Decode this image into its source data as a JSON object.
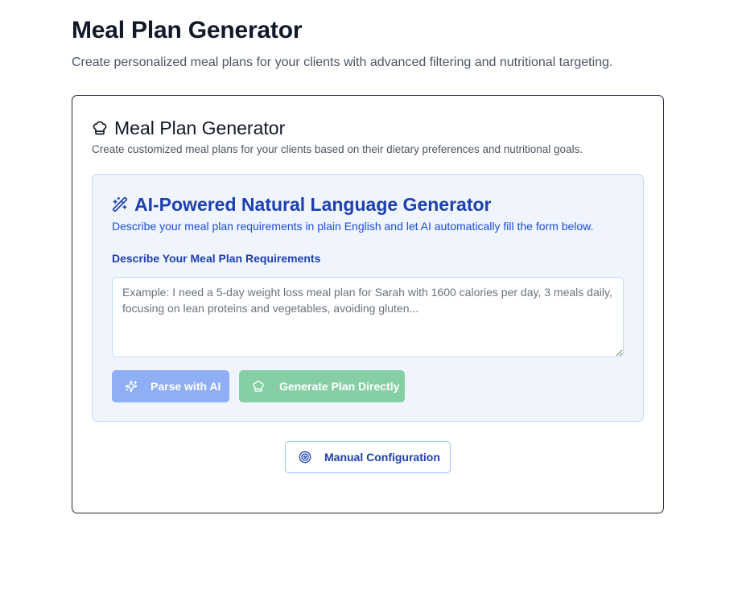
{
  "page": {
    "title": "Meal Plan Generator",
    "subtitle": "Create personalized meal plans for your clients with advanced filtering and nutritional targeting."
  },
  "card": {
    "icon": "chef-hat-icon",
    "title": "Meal Plan Generator",
    "description": "Create customized meal plans for your clients based on their dietary preferences and nutritional goals."
  },
  "ai_panel": {
    "icon": "magic-wand-icon",
    "title": "AI-Powered Natural Language Generator",
    "description": "Describe your meal plan requirements in plain English and let AI automatically fill the form below.",
    "field_label": "Describe Your Meal Plan Requirements",
    "textarea": {
      "value": "",
      "placeholder": "Example: I need a 5-day weight loss meal plan for Sarah with 1600 calories per day, 3 meals daily, focusing on lean proteins and vegetables, avoiding gluten..."
    },
    "buttons": {
      "parse": {
        "label": "Parse with AI",
        "icon": "sparkles-icon",
        "state": "disabled"
      },
      "generate": {
        "label": "Generate Plan Directly",
        "icon": "chef-hat-icon",
        "state": "disabled"
      }
    }
  },
  "manual_button": {
    "label": "Manual Configuration",
    "icon": "target-icon"
  },
  "colors": {
    "heading": "#111827",
    "ai_accent": "#1e40af",
    "ai_panel_bg": "#eff4fd",
    "parse_button_bg": "#8eaef6",
    "generate_button_bg": "#86cfa5",
    "manual_border": "#93c5fd"
  }
}
